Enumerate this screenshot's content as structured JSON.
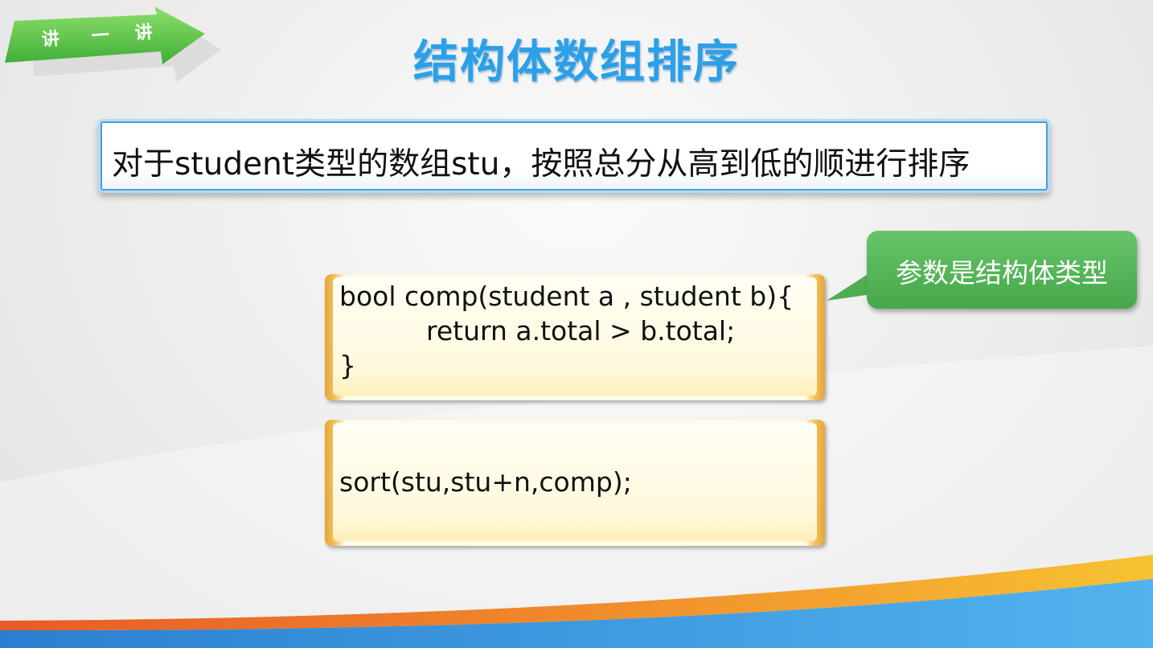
{
  "badge": {
    "chars": [
      "讲",
      "一",
      "讲"
    ]
  },
  "title": "结构体数组排序",
  "statement": "对于student类型的数组stu，按照总分从高到低的顺进行排序",
  "callout": {
    "text": "参数是结构体类型"
  },
  "code_block_1": {
    "line1": "bool comp(student a , student b){",
    "line2": "return a.total > b.total;",
    "line3": "}"
  },
  "code_block_2": {
    "line1": "sort(stu,stu+n,comp);"
  },
  "colors": {
    "title": "#2aa0e8",
    "badge_green": "#5cc443",
    "callout_green": "#4fae52",
    "code_border": "#e6a53a",
    "statement_border": "#4a9ed6"
  }
}
